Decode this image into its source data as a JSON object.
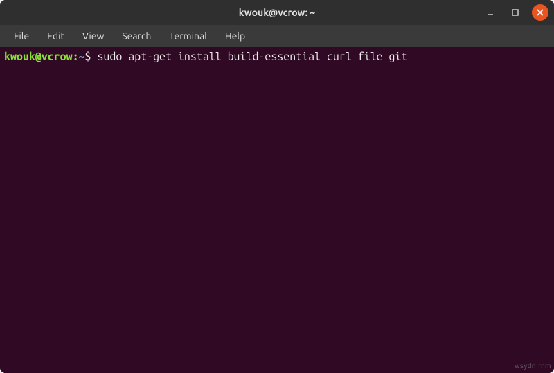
{
  "window": {
    "title": "kwouk@vcrow: ~"
  },
  "menu": {
    "items": [
      "File",
      "Edit",
      "View",
      "Search",
      "Terminal",
      "Help"
    ]
  },
  "terminal": {
    "prompt_user_host": "kwouk@vcrow",
    "prompt_separator": ":",
    "prompt_path": "~",
    "prompt_symbol": "$",
    "command": "sudo apt-get install build-essential curl file git"
  },
  "watermark": "wsydn rnm"
}
